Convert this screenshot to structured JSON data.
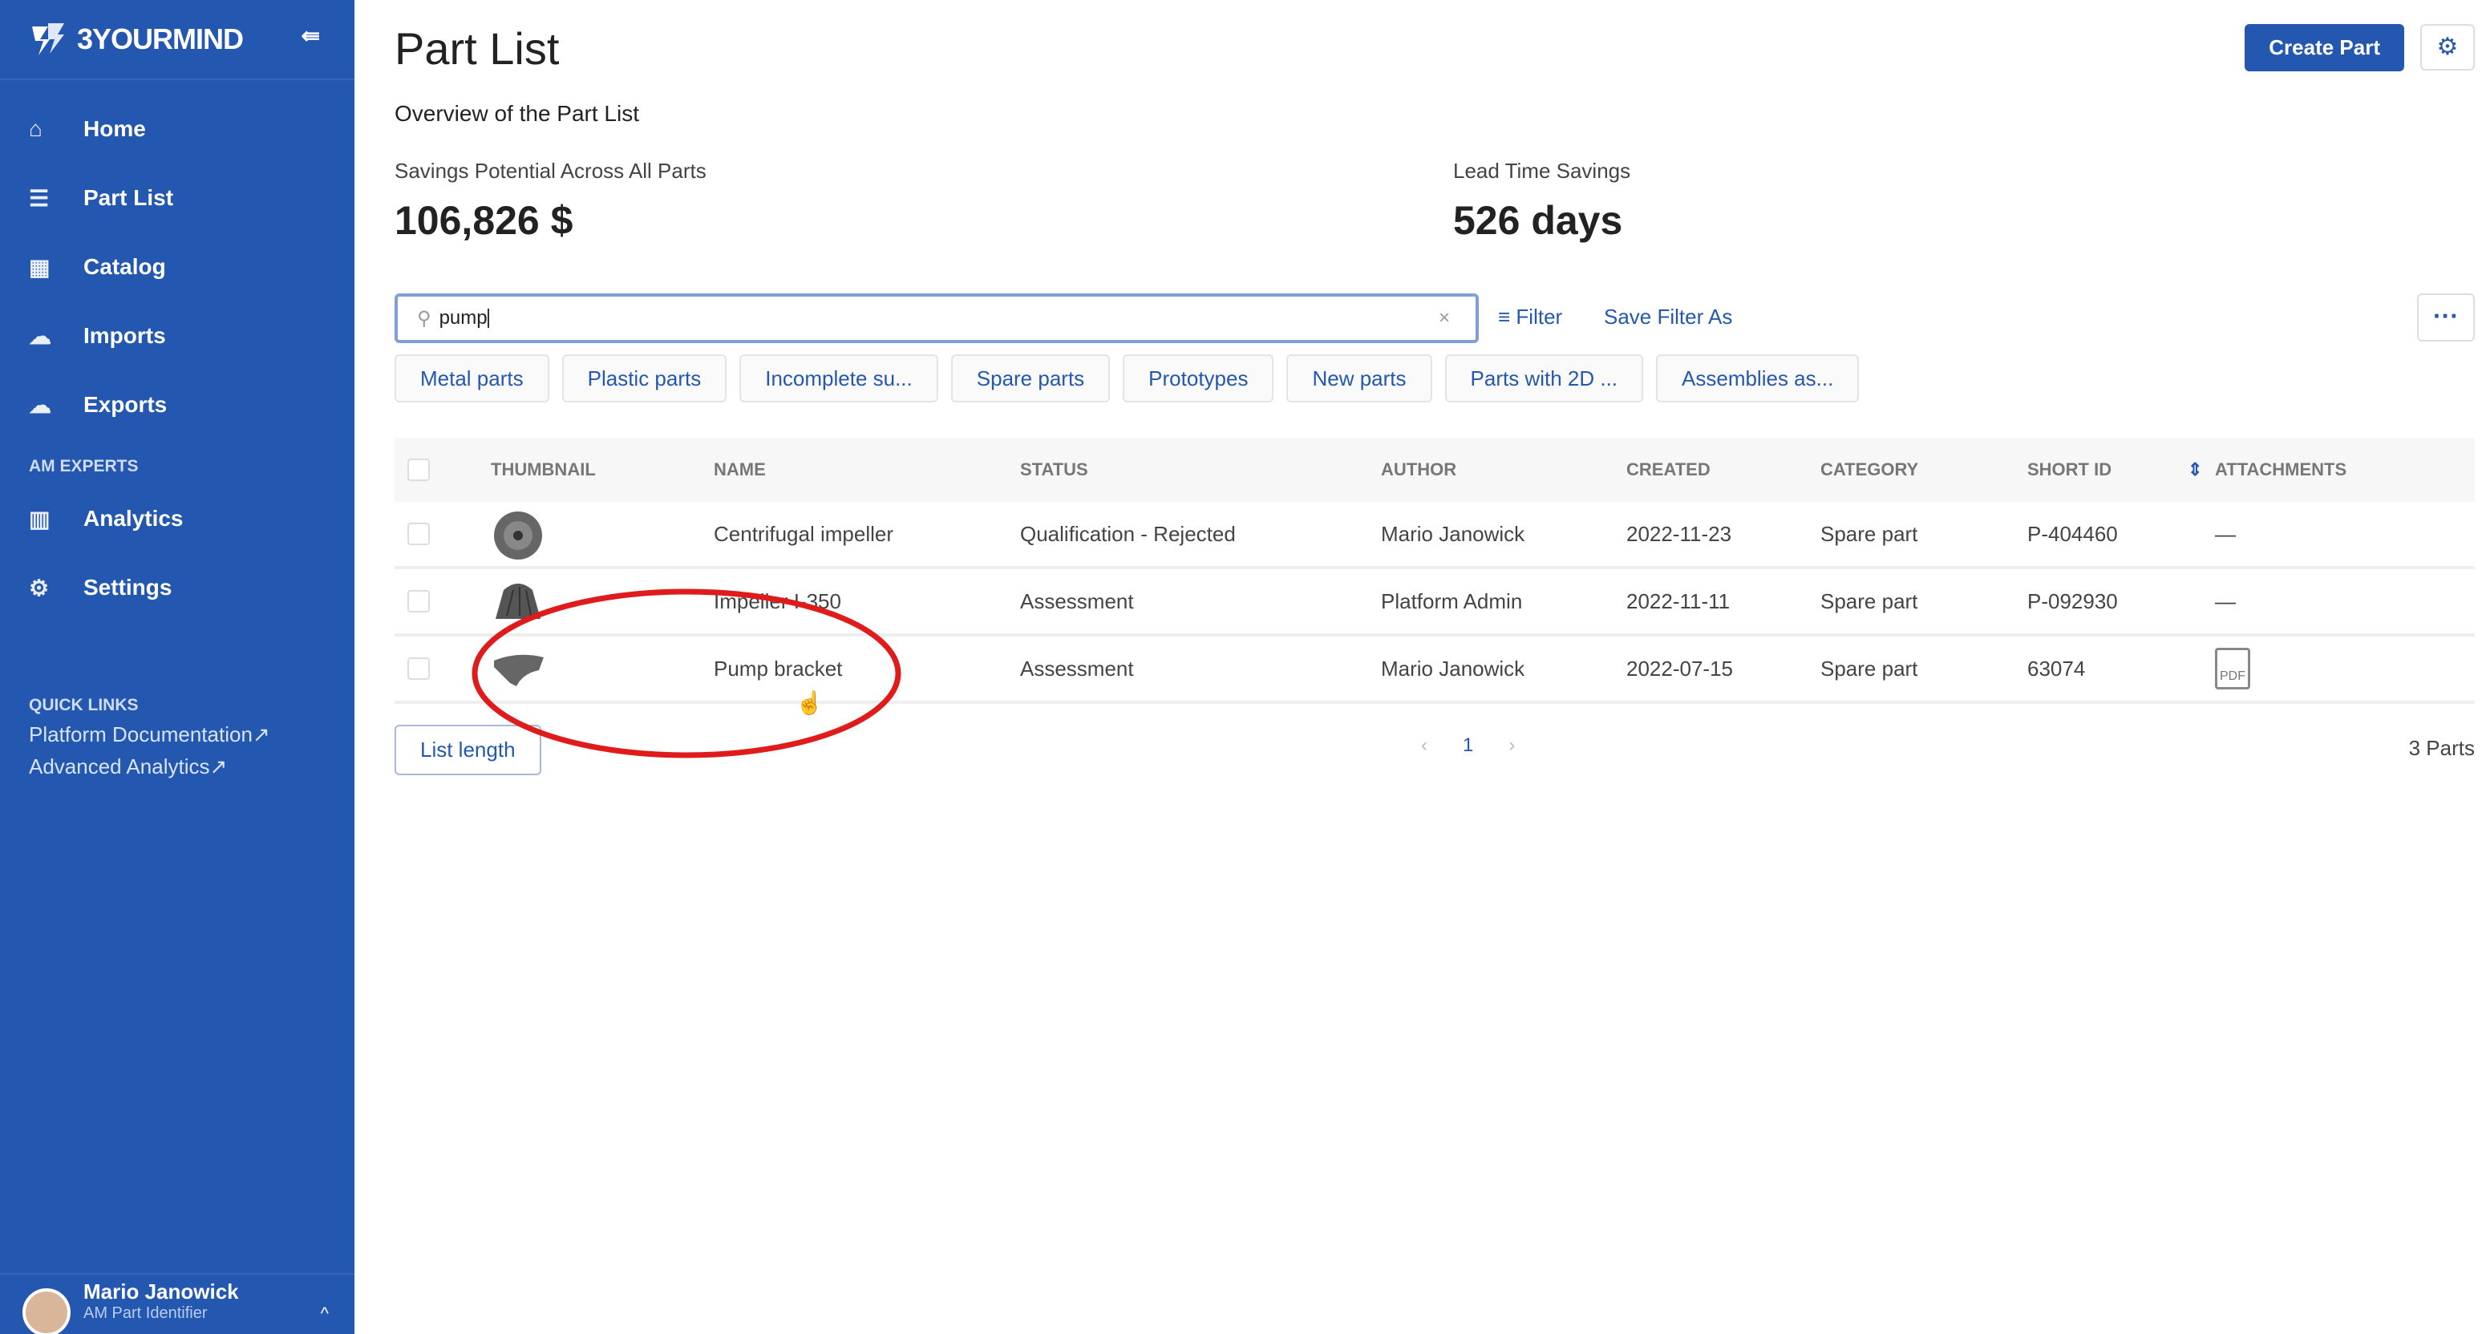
{
  "sidebar": {
    "brand": "3YOURMIND",
    "items": [
      {
        "label": "Home",
        "icon": "home-icon"
      },
      {
        "label": "Part List",
        "icon": "list-icon"
      },
      {
        "label": "Catalog",
        "icon": "catalog-icon"
      },
      {
        "label": "Imports",
        "icon": "upload-cloud-icon"
      },
      {
        "label": "Exports",
        "icon": "download-cloud-icon"
      }
    ],
    "section_am": "AM EXPERTS",
    "am_items": [
      {
        "label": "Analytics",
        "icon": "analytics-icon"
      },
      {
        "label": "Settings",
        "icon": "gear-icon"
      }
    ],
    "quick_links_title": "QUICK LINKS",
    "quick_links": [
      "Platform Documentation",
      "Advanced Analytics"
    ],
    "user": {
      "name": "Mario Janowick",
      "role": "AM Part Identifier"
    }
  },
  "header": {
    "title": "Part List",
    "subtitle": "Overview of the Part List",
    "create_label": "Create Part"
  },
  "kpis": [
    {
      "label": "Savings Potential Across All Parts",
      "value": "106,826 $"
    },
    {
      "label": "Lead Time Savings",
      "value": "526 days"
    }
  ],
  "search": {
    "value": "pump",
    "clear": "×"
  },
  "filter_label": "Filter",
  "save_filter_label": "Save Filter As",
  "more_label": "···",
  "chips": [
    "Metal parts",
    "Plastic parts",
    "Incomplete su...",
    "Spare parts",
    "Prototypes",
    "New parts",
    "Parts with 2D ...",
    "Assemblies as..."
  ],
  "table": {
    "columns": [
      "THUMBNAIL",
      "NAME",
      "STATUS",
      "AUTHOR",
      "CREATED",
      "CATEGORY",
      "SHORT ID",
      "ATTACHMENTS"
    ],
    "rows": [
      {
        "name": "Centrifugal impeller",
        "status": "Qualification - Rejected",
        "author": "Mario Janowick",
        "created": "2022-11-23",
        "category": "Spare part",
        "short_id": "P-404460",
        "attachments": "—"
      },
      {
        "name": "Impeller I-350",
        "status": "Assessment",
        "author": "Platform Admin",
        "created": "2022-11-11",
        "category": "Spare part",
        "short_id": "P-092930",
        "attachments": "—"
      },
      {
        "name": "Pump bracket",
        "status": "Assessment",
        "author": "Mario Janowick",
        "created": "2022-07-15",
        "category": "Spare part",
        "short_id": "63074",
        "attachments": "PDF"
      }
    ]
  },
  "pagination": {
    "prev": "‹",
    "page": "1",
    "next": "›"
  },
  "list_length_label": "List length",
  "count": "3 Parts",
  "colors": {
    "brand": "#2457b0",
    "annotation": "#e01b1b"
  }
}
